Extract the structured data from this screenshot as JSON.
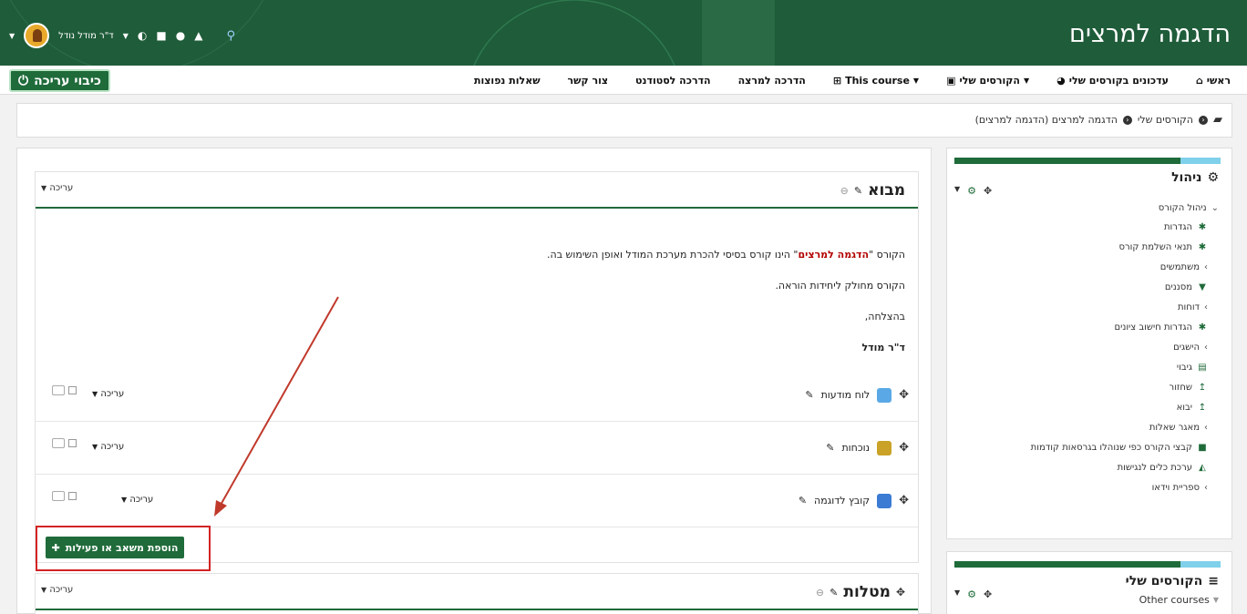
{
  "header": {
    "site_title": "הדגמה למרצים",
    "user_name": "ד\"ר מודל נודל"
  },
  "nav": {
    "items": [
      {
        "label": "ראשי",
        "icon": "home-icon"
      },
      {
        "label": "עדכונים בקורסים שלי",
        "icon": "dashboard-icon"
      },
      {
        "label": "הקורסים שלי",
        "icon": "briefcase-icon",
        "dropdown": true
      },
      {
        "label": "This course",
        "icon": "sitemap-icon",
        "dropdown": true
      },
      {
        "label": "הדרכה למרצה"
      },
      {
        "label": "הדרכה לסטודנט"
      },
      {
        "label": "צור קשר"
      },
      {
        "label": "שאלות נפוצות"
      }
    ],
    "edit_toggle": "כיבוי עריכה"
  },
  "breadcrumb": {
    "items": [
      "הקורסים שלי",
      "הדגמה למרצים (הדגמה למרצים)"
    ]
  },
  "sections": {
    "intro": {
      "title": "מבוא",
      "edit_label": "עריכה",
      "summary_prefix": "הקורס \"",
      "summary_highlight": "הדגמה למרצים",
      "summary_suffix": "\" הינו קורס בסיסי להכרת מערכת המודל ואופן השימוש בה.",
      "line2": "הקורס מחולק ליחידות הוראה.",
      "line3": "בהצלחה,",
      "signature": "ד\"ר מודל"
    },
    "activities": [
      {
        "name": "לוח מודעות",
        "edit_label": "עריכה",
        "color": "#5aa9e6"
      },
      {
        "name": "נוכחות",
        "edit_label": "עריכה",
        "color": "#c9a227"
      },
      {
        "name": "קובץ לדוגמה",
        "edit_label": "עריכה",
        "color": "#3b7bd4"
      }
    ],
    "add_button": "הוספת משאב או פעילות",
    "next_section": {
      "title": "מטלות",
      "edit_label": "עריכה"
    }
  },
  "admin_block": {
    "title": "ניהול",
    "items": [
      {
        "label": "ניהול הקורס",
        "kind": "expanded"
      },
      {
        "label": "הגדרות",
        "kind": "gear-icon"
      },
      {
        "label": "תנאי השלמת קורס",
        "kind": "gear-icon"
      },
      {
        "label": "משתמשים",
        "kind": "collapsed"
      },
      {
        "label": "מסננים",
        "kind": "filter-icon"
      },
      {
        "label": "דוחות",
        "kind": "collapsed"
      },
      {
        "label": "הגדרות חישוב ציונים",
        "kind": "gear-icon"
      },
      {
        "label": "הישגים",
        "kind": "collapsed"
      },
      {
        "label": "גיבוי",
        "kind": "file-icon"
      },
      {
        "label": "שחזור",
        "kind": "upload-icon"
      },
      {
        "label": "יבוא",
        "kind": "upload-icon"
      },
      {
        "label": "מאגר שאלות",
        "kind": "collapsed"
      },
      {
        "label": "קבצי הקורס כפי שנוהלו בגרסאות קודמות",
        "kind": "folder-icon"
      },
      {
        "label": "ערכת כלים לנגישות",
        "kind": "chart-icon"
      },
      {
        "label": "ספריית וידאו",
        "kind": "collapsed"
      }
    ]
  },
  "courses_block": {
    "title": "הקורסים שלי",
    "other_courses": "Other courses"
  }
}
